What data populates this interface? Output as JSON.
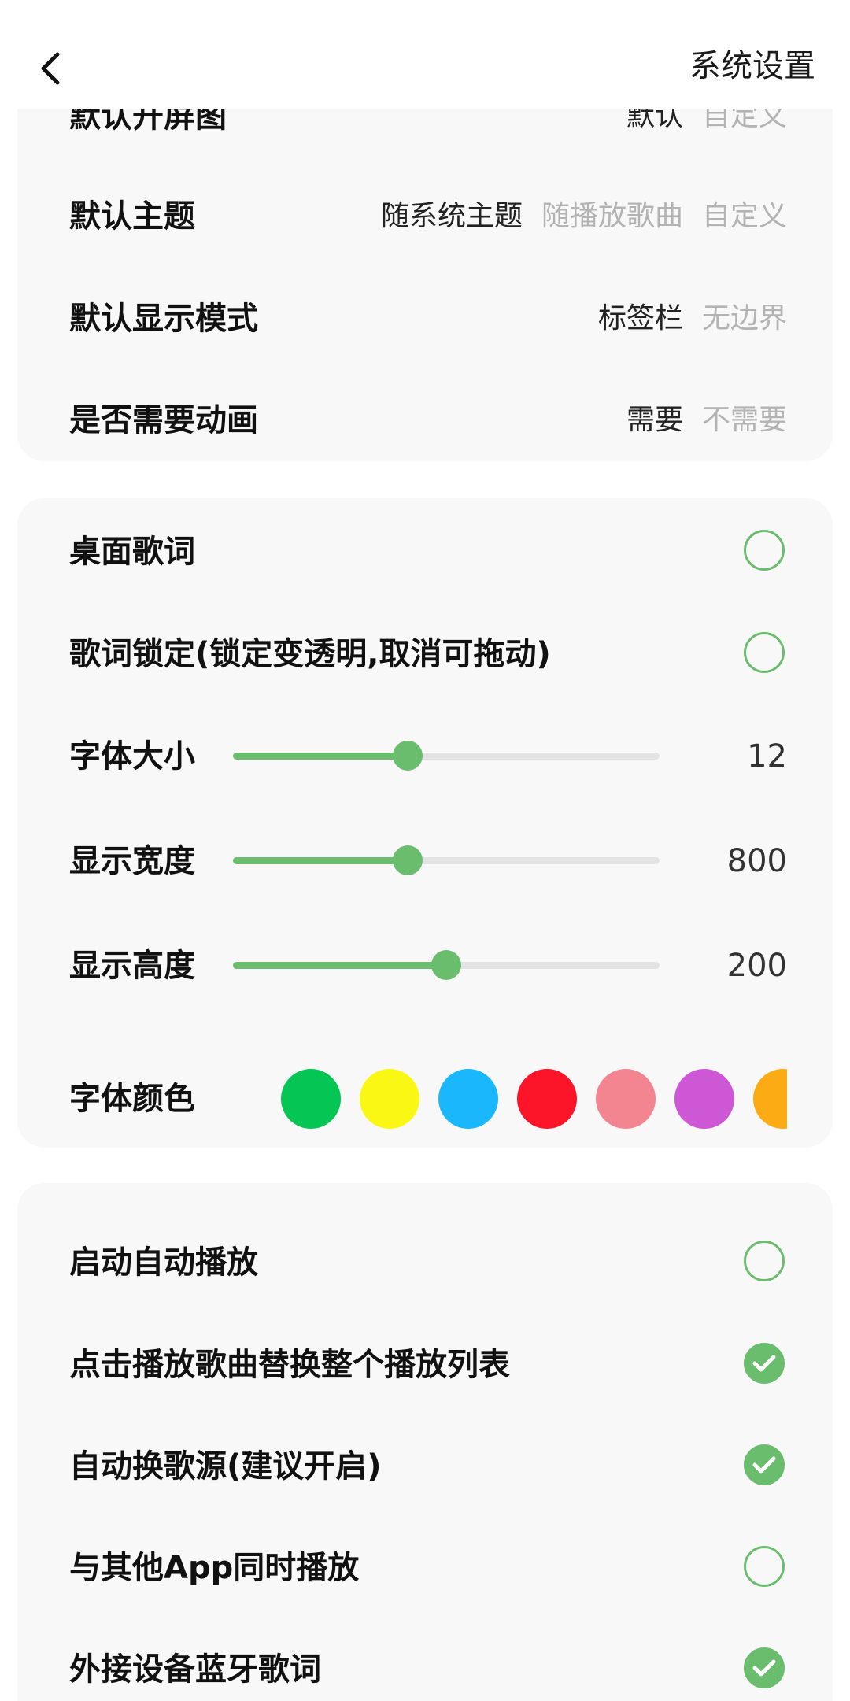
{
  "header": {
    "title": "系统设置"
  },
  "display_settings": {
    "splash": {
      "label": "默认开屏图",
      "options": [
        "默认",
        "自定义"
      ],
      "selected": 0
    },
    "theme": {
      "label": "默认主题",
      "options": [
        "随系统主题",
        "随播放歌曲",
        "自定义"
      ],
      "selected": 0
    },
    "display_mode": {
      "label": "默认显示模式",
      "options": [
        "标签栏",
        "无边界"
      ],
      "selected": 0
    },
    "animation": {
      "label": "是否需要动画",
      "options": [
        "需要",
        "不需要"
      ],
      "selected": 0
    }
  },
  "lyrics_settings": {
    "desktop_lyrics": {
      "label": "桌面歌词",
      "checked": false
    },
    "lyrics_lock": {
      "label": "歌词锁定(锁定变透明,取消可拖动)",
      "checked": false
    },
    "font_size": {
      "label": "字体大小",
      "value": "12",
      "fraction": 0.41
    },
    "display_width": {
      "label": "显示宽度",
      "value": "800",
      "fraction": 0.41
    },
    "display_height": {
      "label": "显示高度",
      "value": "200",
      "fraction": 0.5
    },
    "font_color": {
      "label": "字体颜色",
      "colors": [
        "#05c654",
        "#fbf714",
        "#1ab7fd",
        "#fc1429",
        "#f28590",
        "#cd57d5",
        "#fdab15"
      ]
    }
  },
  "playback_settings": {
    "auto_play": {
      "label": "启动自动播放",
      "checked": false
    },
    "replace_list": {
      "label": "点击播放歌曲替换整个播放列表",
      "checked": true
    },
    "auto_source": {
      "label": "自动换歌源(建议开启)",
      "checked": true
    },
    "mix_with_others": {
      "label": "与其他App同时播放",
      "checked": false
    },
    "bluetooth_lyrics": {
      "label": "外接设备蓝牙歌词",
      "checked": true
    }
  },
  "accent_color": "#6bbd6e"
}
